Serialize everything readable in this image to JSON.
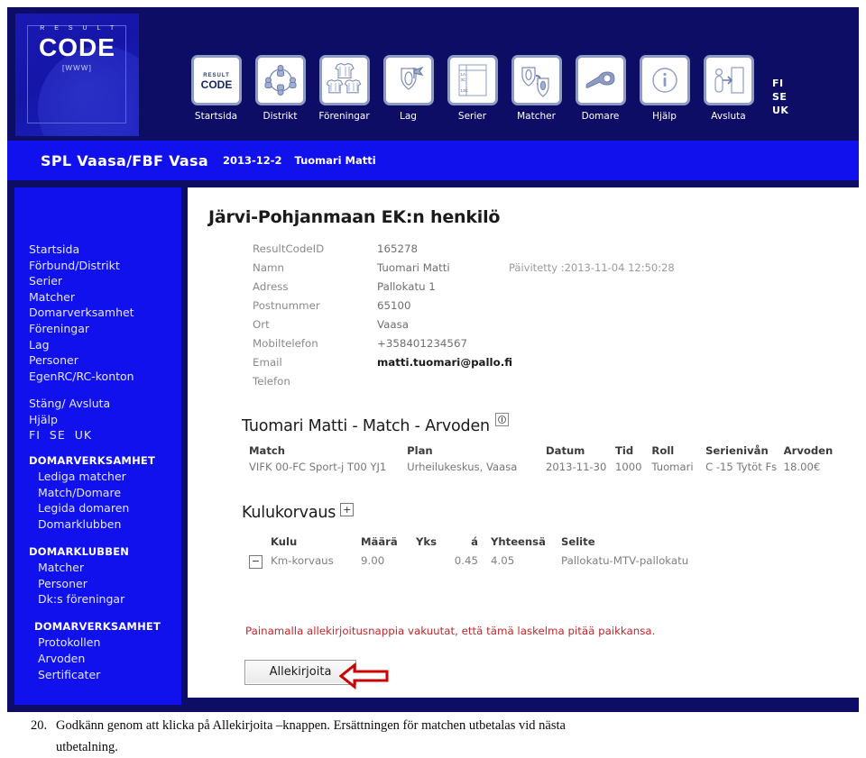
{
  "logo": {
    "result_text": "R E S U L T",
    "code_text": "CODE",
    "www_text": "[WWW]"
  },
  "toolbar": {
    "items": [
      {
        "label": "Startsida",
        "icon": "resultcode-logo-icon"
      },
      {
        "label": "Distrikt",
        "icon": "people-circle-icon"
      },
      {
        "label": "Föreningar",
        "icon": "jerseys-icon"
      },
      {
        "label": "Lag",
        "icon": "shield-flag-icon"
      },
      {
        "label": "Serier",
        "icon": "standings-table-icon"
      },
      {
        "label": "Matcher",
        "icon": "two-shields-vs-icon"
      },
      {
        "label": "Domare",
        "icon": "whistle-icon"
      },
      {
        "label": "Hjälp",
        "icon": "info-circle-icon"
      },
      {
        "label": "Avsluta",
        "icon": "exit-door-icon"
      }
    ],
    "languages": [
      "FI",
      "SE",
      "UK"
    ]
  },
  "info_bar": {
    "organisation": "SPL Vaasa/FBF Vasa",
    "date": "2013-12-2",
    "user": "Tuomari Matti"
  },
  "sidebar": {
    "primary": [
      "Startsida",
      "Förbund/Distrikt",
      "Serier",
      "Matcher",
      "Domarverksamhet",
      "Föreningar",
      "Lag",
      "Personer",
      "EgenRC/RC-konton"
    ],
    "secondary": [
      "Stäng/ Avsluta",
      "Hjälp"
    ],
    "languages": [
      "FI",
      "SE",
      "UK"
    ],
    "groups": [
      {
        "heading": "DOMARVERKSAMHET",
        "items": [
          "Lediga matcher",
          "Match/Domare",
          "Legida domaren",
          "Domarklubben"
        ]
      },
      {
        "heading": "DOMARKLUBBEN",
        "items": [
          "Matcher",
          "Personer",
          "Dk:s föreningar"
        ]
      },
      {
        "heading": "DOMARVERKSAMHET",
        "items": [
          "Protokollen",
          "Arvoden",
          "Sertificater"
        ]
      }
    ]
  },
  "content": {
    "page_title": "Järvi-Pohjanmaan EK:n henkilö",
    "person": {
      "rows": [
        {
          "label": "ResultCodeID",
          "value": "165278",
          "strong": false
        },
        {
          "label": "Namn",
          "value": "Tuomari Matti",
          "strong": false,
          "extra": "Päivitetty :2013-11-04 12:50:28"
        },
        {
          "label": "Adress",
          "value": "Pallokatu 1",
          "strong": false
        },
        {
          "label": "Postnummer",
          "value": "65100",
          "strong": false
        },
        {
          "label": "Ort",
          "value": "Vaasa",
          "strong": false
        },
        {
          "label": "Mobiltelefon",
          "value": "+358401234567",
          "strong": false
        },
        {
          "label": "Email",
          "value": "matti.tuomari@pallo.fi",
          "strong": true
        },
        {
          "label": "Telefon",
          "value": "",
          "strong": false
        }
      ]
    },
    "match_section": {
      "title": "Tuomari Matti - Match - Arvoden",
      "info_icon": "info-box-icon",
      "columns": [
        "Match",
        "Plan",
        "Datum",
        "Tid",
        "Roll",
        "Serienivån",
        "Arvoden"
      ],
      "rows": [
        {
          "match": "VIFK 00-FC Sport-j T00 YJ1",
          "plan": "Urheilukeskus, Vaasa",
          "datum": "2013-11-30",
          "tid": "1000",
          "roll": "Tuomari",
          "serieniva": "C -15 Tytöt Fs",
          "arvoden": "18.00€"
        }
      ]
    },
    "kulu_section": {
      "title": "Kulukorvaus",
      "add_button": "+",
      "columns": [
        "Kulu",
        "Määrä",
        "Yks",
        "á",
        "Yhteensä",
        "Selite"
      ],
      "rows": [
        {
          "remove_button": "−",
          "kulu": "Km-korvaus",
          "maara": "9.00",
          "yks": "",
          "a": "0.45",
          "yhteensa": "4.05",
          "selite": "Pallokatu-MTV-pallokatu"
        }
      ]
    },
    "warning": "Painamalla allekirjoitusnappia vakuutat, että tämä laskelma pitää paikkansa.",
    "sign_button": "Allekirjoita",
    "arrow": "left-arrow-annotation"
  },
  "caption": {
    "number": "20.",
    "line1": "Godkänn genom att klicka på Allekirjoita –knappen. Ersättningen för matchen utbetalas vid nästa",
    "line2": "utbetalning."
  },
  "colors": {
    "header_navy": "#0d0d66",
    "bar_blue": "#1111ee",
    "content_white": "#ffffff",
    "warning_red": "#c0282d",
    "icon_frame": "#8e9cc4",
    "arrow_red": "#cc0000"
  }
}
